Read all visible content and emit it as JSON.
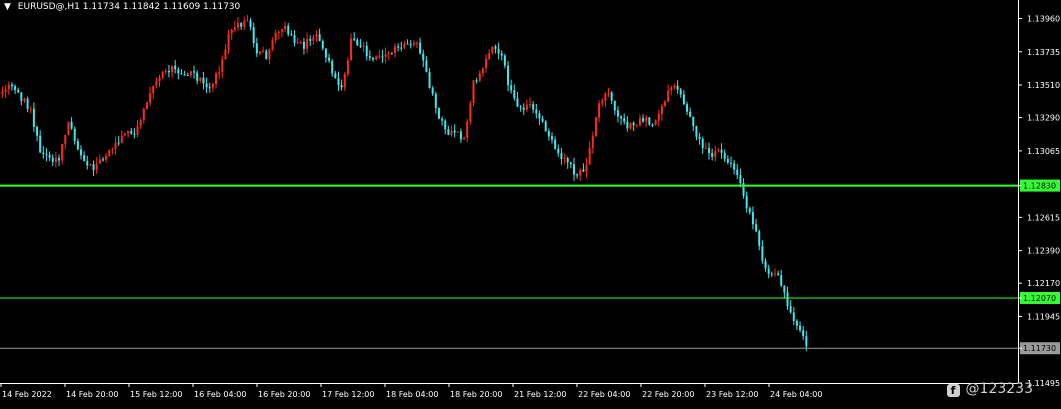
{
  "header": {
    "symbol": "EURUSD@,H1",
    "ohlc": "1.11734 1.11842 1.11609 1.11730",
    "menu_icon": "triangle-down-icon"
  },
  "watermark": {
    "text": "@123233",
    "icon": "social-f-icon"
  },
  "colors": {
    "background": "#000000",
    "bull": "#ff2a1a",
    "bear": "#3ee8ee",
    "level_line": "#33ff33",
    "last_price_line": "#9a9a9a",
    "axis": "#ffffff"
  },
  "chart_data": {
    "type": "candlestick",
    "title": "",
    "xlabel": "",
    "ylabel": "",
    "ylim": [
      1.11495,
      1.14085
    ],
    "y_ticks": [
      "1.13960",
      "1.13735",
      "1.13510",
      "1.13290",
      "1.13065",
      "1.12830",
      "1.12615",
      "1.12390",
      "1.12170",
      "1.12070",
      "1.11945",
      "1.11730",
      "1.11495"
    ],
    "x_ticks": [
      "14 Feb 2022",
      "14 Feb 20:00",
      "15 Feb 12:00",
      "16 Feb 04:00",
      "16 Feb 20:00",
      "17 Feb 12:00",
      "18 Feb 04:00",
      "18 Feb 20:00",
      "21 Feb 12:00",
      "22 Feb 04:00",
      "22 Feb 20:00",
      "23 Feb 12:00",
      "24 Feb 04:00"
    ],
    "levels": [
      {
        "price": 1.1283,
        "label": "1.12830",
        "color": "#33ff33",
        "width": 2
      },
      {
        "price": 1.1207,
        "label": "1.12070",
        "color": "#33ff33",
        "width": 1
      },
      {
        "price": 1.1173,
        "label": "1.11730",
        "color": "#9a9a9a",
        "width": 1
      }
    ],
    "close_path": [
      [
        0,
        1.1345
      ],
      [
        3,
        1.1352
      ],
      [
        6,
        1.1343
      ],
      [
        9,
        1.1334
      ],
      [
        12,
        1.1308
      ],
      [
        15,
        1.1302
      ],
      [
        18,
        1.13
      ],
      [
        21,
        1.1328
      ],
      [
        24,
        1.1305
      ],
      [
        27,
        1.1296
      ],
      [
        30,
        1.1296
      ],
      [
        33,
        1.1305
      ],
      [
        36,
        1.1312
      ],
      [
        39,
        1.1316
      ],
      [
        42,
        1.132
      ],
      [
        45,
        1.1335
      ],
      [
        48,
        1.1352
      ],
      [
        51,
        1.1357
      ],
      [
        54,
        1.1363
      ],
      [
        57,
        1.136
      ],
      [
        60,
        1.1358
      ],
      [
        63,
        1.1355
      ],
      [
        66,
        1.135
      ],
      [
        69,
        1.136
      ],
      [
        72,
        1.1385
      ],
      [
        75,
        1.1392
      ],
      [
        78,
        1.1395
      ],
      [
        81,
        1.1375
      ],
      [
        84,
        1.137
      ],
      [
        87,
        1.1385
      ],
      [
        90,
        1.1392
      ],
      [
        93,
        1.138
      ],
      [
        96,
        1.1378
      ],
      [
        99,
        1.1385
      ],
      [
        102,
        1.1378
      ],
      [
        105,
        1.136
      ],
      [
        108,
        1.135
      ],
      [
        111,
        1.138
      ],
      [
        114,
        1.1378
      ],
      [
        117,
        1.137
      ],
      [
        120,
        1.1368
      ],
      [
        123,
        1.1372
      ],
      [
        126,
        1.1376
      ],
      [
        129,
        1.138
      ],
      [
        132,
        1.138
      ],
      [
        135,
        1.136
      ],
      [
        138,
        1.1335
      ],
      [
        141,
        1.132
      ],
      [
        144,
        1.1318
      ],
      [
        147,
        1.1315
      ],
      [
        150,
        1.1352
      ],
      [
        153,
        1.1365
      ],
      [
        156,
        1.1375
      ],
      [
        159,
        1.137
      ],
      [
        162,
        1.1345
      ],
      [
        165,
        1.1335
      ],
      [
        168,
        1.1338
      ],
      [
        171,
        1.133
      ],
      [
        174,
        1.1315
      ],
      [
        177,
        1.1305
      ],
      [
        180,
        1.1298
      ],
      [
        183,
        1.129
      ],
      [
        186,
        1.1295
      ],
      [
        189,
        1.133
      ],
      [
        192,
        1.1348
      ],
      [
        195,
        1.1335
      ],
      [
        198,
        1.1325
      ],
      [
        201,
        1.1322
      ],
      [
        204,
        1.1328
      ],
      [
        207,
        1.1325
      ],
      [
        210,
        1.1335
      ],
      [
        213,
        1.135
      ],
      [
        216,
        1.1345
      ],
      [
        219,
        1.133
      ],
      [
        222,
        1.1312
      ],
      [
        225,
        1.1305
      ],
      [
        228,
        1.1305
      ],
      [
        231,
        1.13
      ],
      [
        234,
        1.129
      ],
      [
        237,
        1.127
      ],
      [
        240,
        1.125
      ],
      [
        243,
        1.1225
      ],
      [
        246,
        1.1225
      ],
      [
        249,
        1.121
      ],
      [
        252,
        1.119
      ],
      [
        255,
        1.1182
      ],
      [
        256,
        1.1175
      ]
    ],
    "candle_count": 257
  }
}
